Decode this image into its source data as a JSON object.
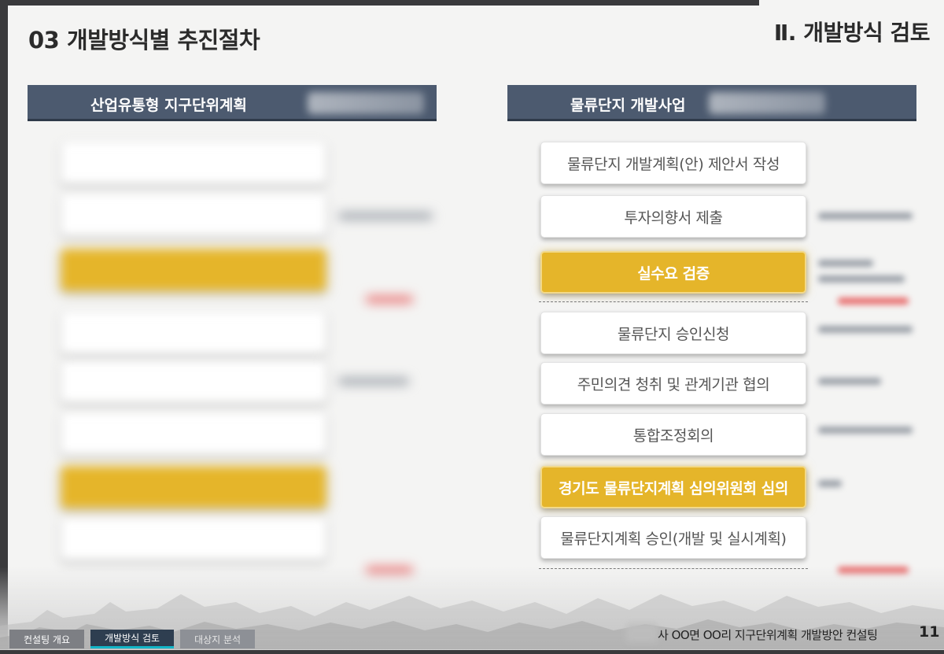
{
  "header": {
    "page_heading": "03 개발방식별 추진절차",
    "chapter_title": "Ⅱ. 개발방식 검토"
  },
  "left_column": {
    "title": "산업유통형 지구단위계획",
    "steps": [
      "",
      "",
      "",
      "",
      "",
      "",
      "",
      ""
    ]
  },
  "right_column": {
    "title": "물류단지 개발사업",
    "steps": [
      "물류단지 개발계획(안) 제안서 작성",
      "투자의향서 제출",
      "실수요 검증",
      "물류단지 승인신청",
      "주민의견 청취 및 관계기관 협의",
      "통합조정회의",
      "경기도 물류단지계획 심의위원회 심의",
      "물류단지계획 승인(개발 및 실시계획)"
    ]
  },
  "nav": {
    "tabs": [
      "컨설팅 개요",
      "개발방식 검토",
      "대상지 분석"
    ]
  },
  "footer": {
    "title": "사 OO면 OO리 지구단위계획 개발방안 컨설팅",
    "page_number": "11"
  },
  "colors": {
    "header_bar": "#4c5a6f",
    "highlight": "#e5b52a",
    "nav_active": "#2e3e50",
    "nav_accent": "#13b6c8"
  }
}
